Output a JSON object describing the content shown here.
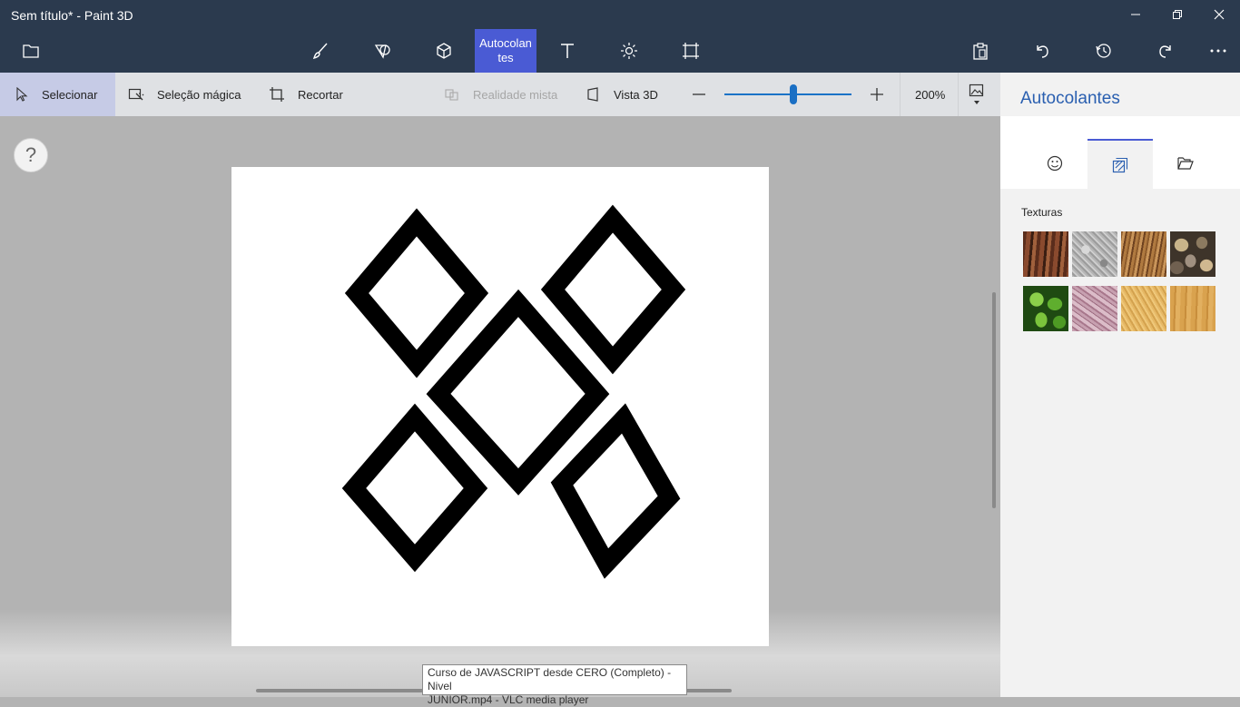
{
  "window": {
    "title": "Sem título* - Paint 3D"
  },
  "topbar": {
    "active_tool_label": "Autocolan tes",
    "icons": [
      "folder-icon",
      "brush-icon",
      "2d-shapes-icon",
      "3d-shapes-icon",
      "stickers",
      "text-icon",
      "effects-icon",
      "canvas-icon",
      "paste-icon",
      "undo-icon",
      "history-icon",
      "redo-icon",
      "more-icon"
    ]
  },
  "toolbar": {
    "select_label": "Selecionar",
    "magic_select_label": "Seleção mágica",
    "crop_label": "Recortar",
    "mixed_reality_label": "Realidade mista",
    "view3d_label": "Vista 3D",
    "zoom_value": "200%",
    "zoom_slider_fraction": 0.54
  },
  "canvas": {
    "help_label": "?"
  },
  "tooltip": {
    "line1": "Curso de JAVASCRIPT desde CERO (Completo) - Nivel",
    "line2": "JUNIOR.mp4 - VLC media player"
  },
  "panel": {
    "title": "Autocolantes",
    "section_label": "Texturas",
    "tabs": [
      "stickers-tab",
      "textures-tab",
      "custom-stickers-tab"
    ],
    "textures": [
      "bark",
      "granite",
      "hair",
      "pebbles",
      "leaves",
      "pink-marble",
      "sand",
      "wood"
    ]
  },
  "colors": {
    "accent": "#4a5bd4",
    "titlebar": "#2b3a4e",
    "panel_title": "#2a5fb0"
  }
}
